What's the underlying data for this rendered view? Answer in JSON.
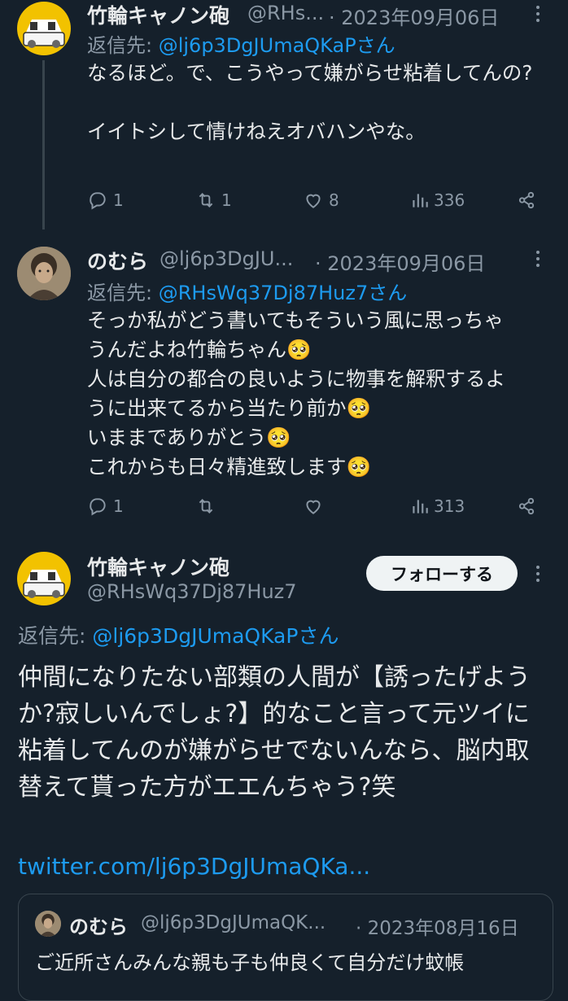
{
  "tweets": [
    {
      "name": "竹輪キャノン砲",
      "handle": "@RHs...",
      "date": "· 2023年09月06日",
      "reply_to_prefix": "返信先: ",
      "reply_to_handle": "@lj6p3DgJUmaQKaPさん",
      "text": "なるほど。で、こうやって嫌がらせ粘着してんの?\n\nイイトシして情けねえオバハンやな。",
      "replies": "1",
      "retweets": "1",
      "likes": "8",
      "views": "336"
    },
    {
      "name": "のむら",
      "handle": "@lj6p3DgJU...",
      "date": "· 2023年09月06日",
      "reply_to_prefix": "返信先: ",
      "reply_to_handle": "@RHsWq37Dj87Huz7さん",
      "lines": [
        "そっか私がどう書いてもそういう風に思っちゃ",
        "うんだよね竹輪ちゃん🥺",
        "人は自分の都合の良いように物事を解釈するよ",
        "うに出来てるから当たり前か🥺",
        "いままでありがとう🥺",
        "これからも日々精進致します🥺"
      ],
      "replies": "1",
      "retweets": "",
      "likes": "",
      "views": "313"
    }
  ],
  "main": {
    "name": "竹輪キャノン砲",
    "handle": "@RHsWq37Dj87Huz7",
    "follow_label": "フォローする",
    "reply_to_prefix": "返信先: ",
    "reply_to_handle": "@lj6p3DgJUmaQKaPさん",
    "text": "仲間になりたない部類の人間が【誘ったげようか?寂しいんでしょ?】的なこと言って元ツイに粘着してんのが嫌がらせでないんなら、脳内取替えて貰った方がエエんちゃう?笑",
    "link": "twitter.com/lj6p3DgJUmaQKa..."
  },
  "quote": {
    "name": "のむら",
    "handle": "@lj6p3DgJUmaQK...",
    "date": "· 2023年08月16日",
    "text": "ご近所さんみんな親も子も仲良くて自分だけ蚊帳"
  },
  "colors": {
    "background": "#15202b",
    "text": "#e7e9ea",
    "muted": "#8b98a5",
    "link": "#1d9bf0"
  }
}
